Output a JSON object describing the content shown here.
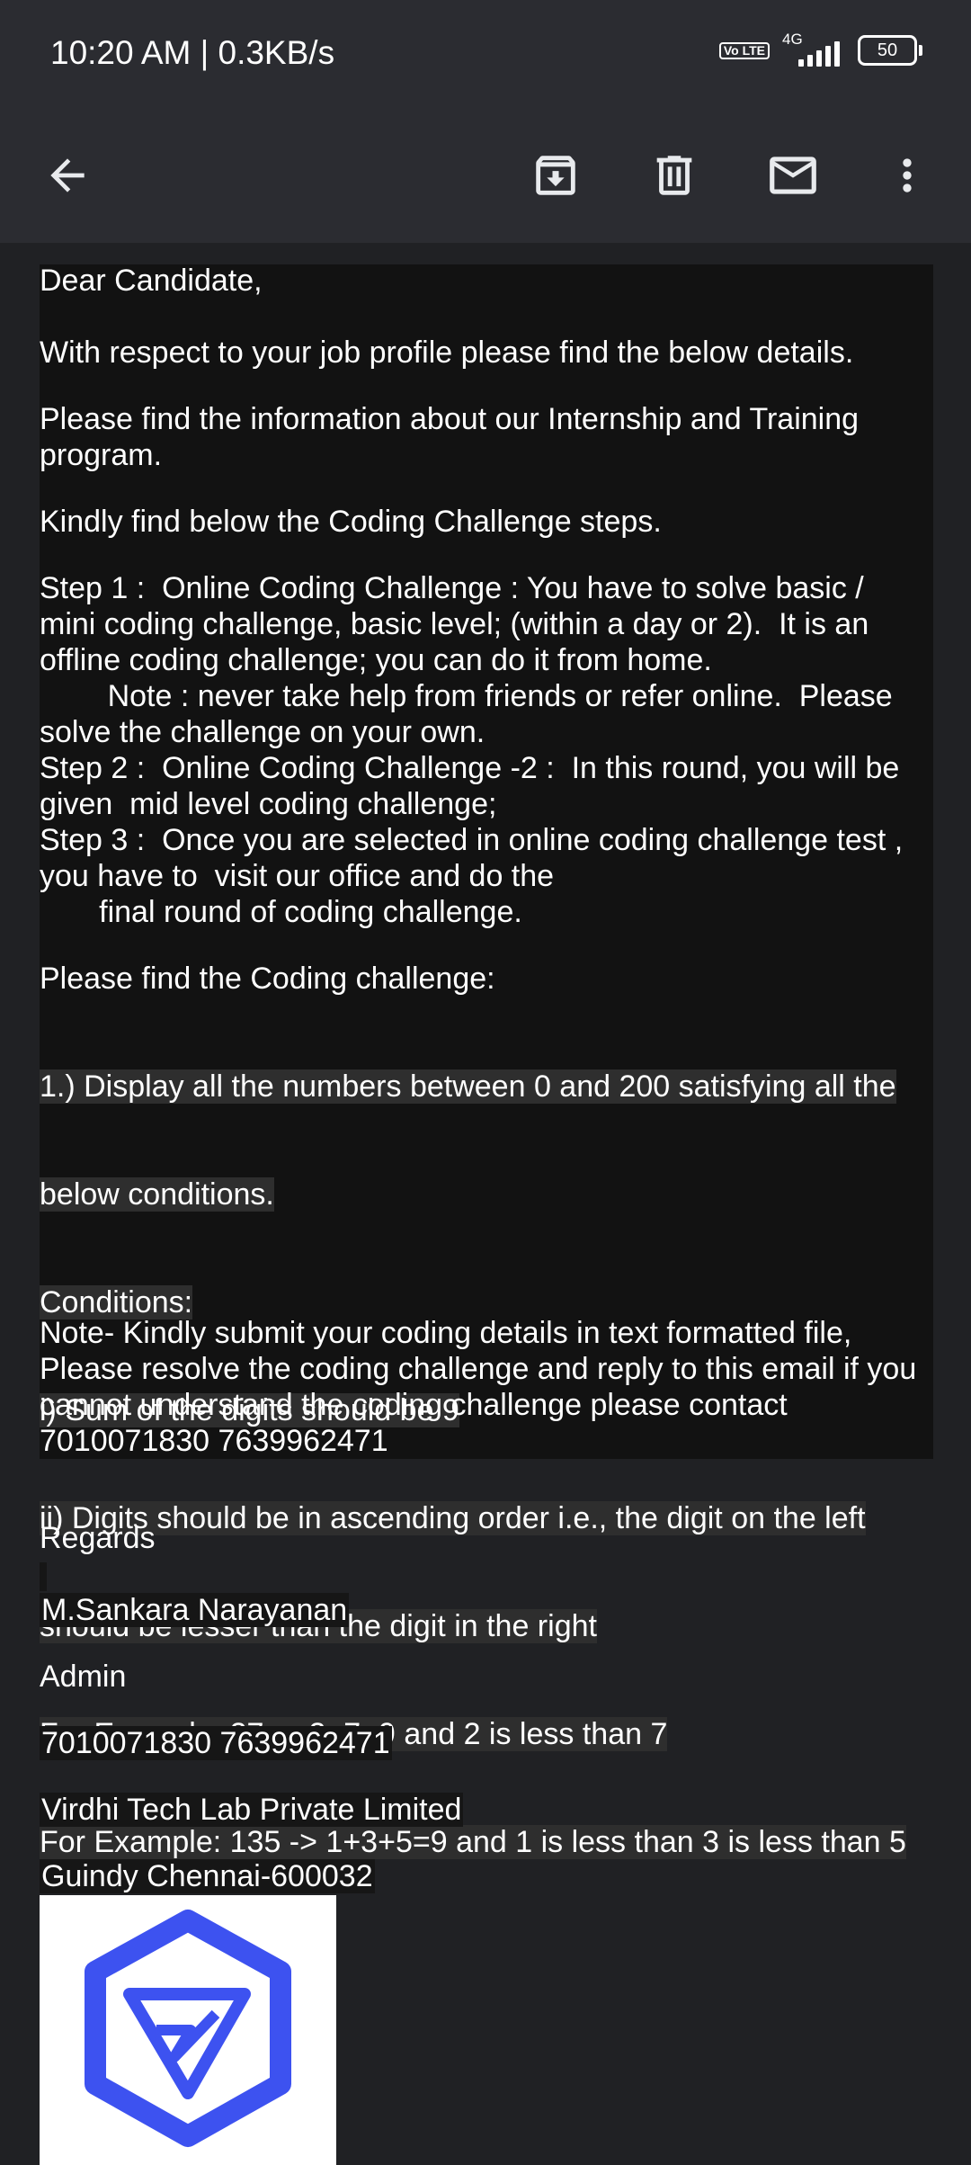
{
  "status_bar": {
    "time": "10:20 AM | 0.3KB/s",
    "volte": "Vo LTE",
    "network": "4G",
    "battery": "50"
  },
  "toolbar": {
    "icons": [
      "back-arrow-icon",
      "archive-icon",
      "delete-icon",
      "mark-unread-icon",
      "more-vert-icon"
    ]
  },
  "email": {
    "greeting": "Dear Candidate,",
    "p1": "With respect to your job profile please find the below details.",
    "p2": "Please find the information about our Internship and Training\nprogram.",
    "p3": "Kindly find below the Coding Challenge steps.",
    "steps": "Step 1 :  Online Coding Challenge : You have to solve basic /\nmini coding challenge, basic level; (within a day or 2).  It is an\noffline coding challenge; you can do it from home.\n        Note : never take help from friends or refer online.  Please\nsolve the challenge on your own.\nStep 2 :  Online Coding Challenge -2 :  In this round, you will be\ngiven  mid level coding challenge;\nStep 3 :  Once you are selected in online coding challenge test ,\nyou have to  visit our office and do the\n       final round of coding challenge.",
    "challenge_intro": "Please find the Coding challenge:",
    "challenge_lines": [
      "1.) Display all the numbers between 0 and 200 satisfying all the",
      "below conditions.",
      "Conditions:",
      "i) Sum of the digits should be 9",
      "ii) Digits should be in ascending order i.e., the digit on the left",
      "should be lesser than the digit in the right",
      "For Example: 27 -> 2+7=9 and 2 is less than 7",
      "For Example: 135 -> 1+3+5=9 and 1 is less than 3 is less than 5"
    ],
    "note": "Note- Kindly submit your coding details in text formatted file,\nPlease resolve the coding challenge and reply to this email if you\ncannot understand the coding challenge please contact\n7010071830 7639962471"
  },
  "signature": {
    "regards": "Regards",
    "name": "M.Sankara Narayanan",
    "title": "Admin",
    "phones": "7010071830 7639962471",
    "company": "Virdhi Tech Lab Private Limited",
    "address": "Guindy Chennai-600032"
  },
  "colors": {
    "background": "#202124",
    "toolbar": "#2b2c31",
    "message_box": "#121212",
    "highlight": "#2e2e2e",
    "logo_blue": "#3d52f0"
  }
}
